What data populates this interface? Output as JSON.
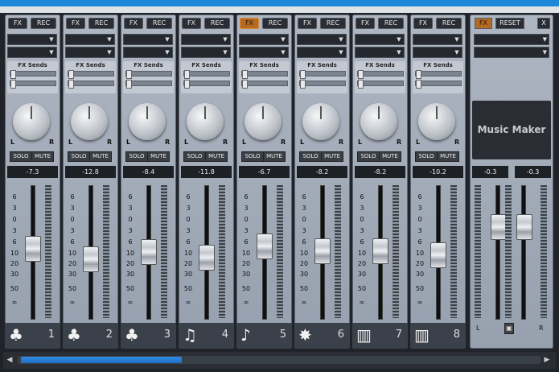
{
  "channels": [
    {
      "label": "1",
      "value": "-7.3",
      "icon": "ensemble-icon",
      "glyph": "♣",
      "fx_active": false,
      "fader": 0.46
    },
    {
      "label": "2",
      "value": "-12.8",
      "icon": "ensemble-icon",
      "glyph": "♣",
      "fx_active": false,
      "fader": 0.36
    },
    {
      "label": "3",
      "value": "-8.4",
      "icon": "ensemble-icon",
      "glyph": "♣",
      "fx_active": false,
      "fader": 0.43
    },
    {
      "label": "4",
      "value": "-11.8",
      "icon": "guitar-icon",
      "glyph": "♫",
      "fx_active": false,
      "fader": 0.38
    },
    {
      "label": "5",
      "value": "-6.7",
      "icon": "trumpet-icon",
      "glyph": "♪",
      "fx_active": true,
      "fader": 0.48
    },
    {
      "label": "6",
      "value": "-8.2",
      "icon": "fx-burst-icon",
      "glyph": "✸",
      "fx_active": false,
      "fader": 0.44
    },
    {
      "label": "7",
      "value": "-8.2",
      "icon": "keyboard-icon",
      "glyph": "▥",
      "fx_active": false,
      "fader": 0.44
    },
    {
      "label": "8",
      "value": "-10.2",
      "icon": "keyboard-icon",
      "glyph": "▥",
      "fx_active": false,
      "fader": 0.4
    }
  ],
  "labels": {
    "fx": "FX",
    "rec": "REC",
    "sends": "FX Sends",
    "solo": "SOLO",
    "mute": "MUTE",
    "l": "L",
    "r": "R",
    "reset": "RESET",
    "close": "X"
  },
  "scale": [
    "6",
    "3",
    "0",
    "3",
    "6",
    "10",
    "20",
    "30",
    "50",
    "∞"
  ],
  "master": {
    "logo": "Music Maker",
    "left_value": "-0.3",
    "right_value": "-0.3",
    "left_fader": 0.66,
    "right_fader": 0.66,
    "fx_active": true
  },
  "colors": {
    "accent": "#1e88d8",
    "fx_active": "#b46a22"
  }
}
